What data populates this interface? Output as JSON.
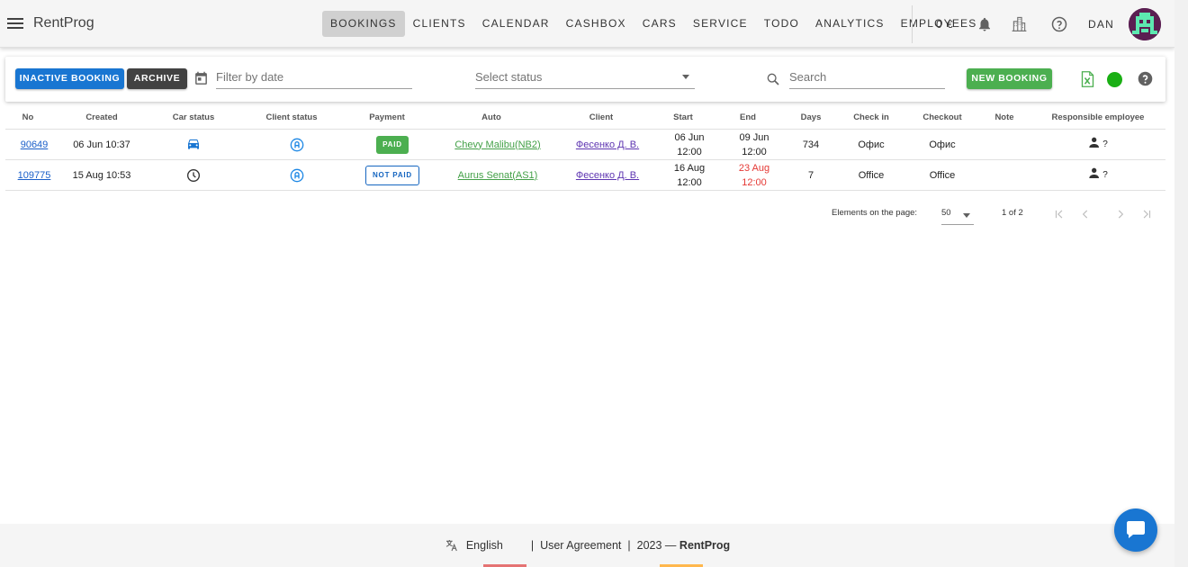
{
  "app": {
    "title": "RentProg"
  },
  "nav": {
    "items": [
      {
        "label": "BOOKINGS",
        "active": true
      },
      {
        "label": "CLIENTS"
      },
      {
        "label": "CALENDAR"
      },
      {
        "label": "CASHBOX"
      },
      {
        "label": "CARS"
      },
      {
        "label": "SERVICE"
      },
      {
        "label": "TODO"
      },
      {
        "label": "ANALYTICS"
      },
      {
        "label": "EMPLOYEES"
      }
    ]
  },
  "header": {
    "balance": "0 €",
    "user": "DAN"
  },
  "icons": {
    "menu": "menu-icon",
    "bell": "bell-icon",
    "city": "city-icon",
    "help": "help-circle-icon",
    "calendar": "calendar-icon",
    "search": "search-icon",
    "excel": "excel-icon",
    "status_dot": "online-status-icon"
  },
  "colors": {
    "primary": "#1976d2",
    "success": "#4caf50",
    "dark": "#424242",
    "danger": "#e53935"
  },
  "toolbar": {
    "inactive_label": "INACTIVE BOOKING",
    "archive_label": "ARCHIVE",
    "date_placeholder": "Filter by date",
    "status_placeholder": "Select status",
    "search_placeholder": "Search",
    "new_booking_label": "NEW BOOKING"
  },
  "table": {
    "headers": [
      "No",
      "Created",
      "Car status",
      "Client status",
      "Payment",
      "Auto",
      "Client",
      "Start",
      "End",
      "Days",
      "Check in",
      "Checkout",
      "Note",
      "Responsible employee"
    ],
    "rows": [
      {
        "no": "90649",
        "created": "06 Jun 10:37",
        "car_status": "car-icon",
        "client_status": "client-a-icon",
        "payment": "PAID",
        "auto": "Chevy Malibu(NB2)",
        "client": "Фесенко Д. В.",
        "start_date": "06 Jun",
        "start_time": "12:00",
        "end_date": "09 Jun",
        "end_time": "12:00",
        "days": "734",
        "checkin": "Офис",
        "checkout": "Офис",
        "note": "",
        "employee": "?"
      },
      {
        "no": "109775",
        "created": "15 Aug 10:53",
        "car_status": "clock-icon",
        "client_status": "client-a-icon",
        "payment": "NOT PAID",
        "auto": "Aurus Senat(AS1)",
        "client": "Фесенко Д. В.",
        "start_date": "16 Aug",
        "start_time": "12:00",
        "end_date": "23 Aug",
        "end_time": "12:00",
        "days": "7",
        "checkin": "Office",
        "checkout": "Office",
        "note": "",
        "employee": "?"
      }
    ]
  },
  "pagination": {
    "label": "Elements on the page:",
    "per_page": "50",
    "range": "1 of 2"
  },
  "footer": {
    "language": "English",
    "agreement": "User Agreement",
    "year": "2023 —",
    "brand": "RentProg"
  }
}
